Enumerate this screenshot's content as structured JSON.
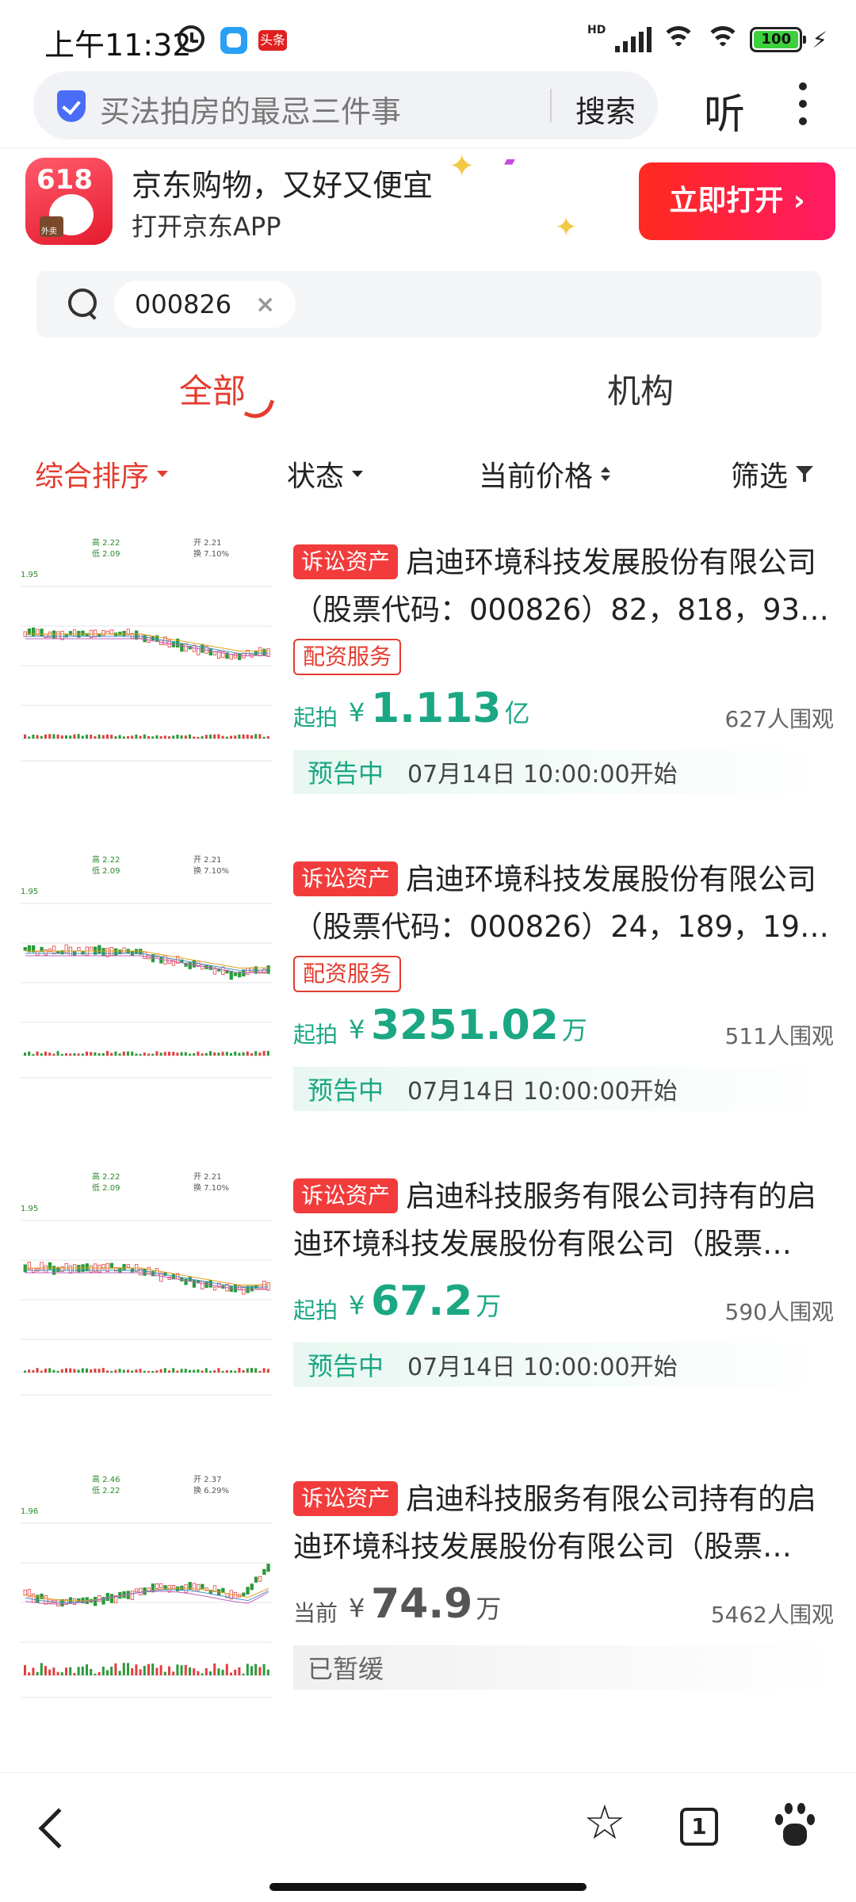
{
  "status_bar": {
    "time": "上午11:32",
    "news_badge": "头条",
    "network_badge": "HD",
    "battery": "100"
  },
  "browser": {
    "query": "买法拍房的最忌三件事",
    "search_label": "搜索",
    "listen_label": "听"
  },
  "jd_banner": {
    "logo_text": "618",
    "logo_tag": "外卖",
    "title": "京东购物，又好又便宜",
    "subtitle": "打开京东APP",
    "open_button": "立即打开 ›"
  },
  "search": {
    "chip_text": "000826",
    "clear_icon": "×"
  },
  "tabs": [
    {
      "label": "全部",
      "active": true
    },
    {
      "label": "机构",
      "active": false
    }
  ],
  "filters": {
    "sort": "综合排序",
    "status": "状态",
    "price": "当前价格",
    "filter": "筛选"
  },
  "listings": [
    {
      "tag": "诉讼资产",
      "title": "启迪环境科技发展股份有限公司（股票代码：000826）82，818，93…",
      "service_tag": "配资服务",
      "price_label": "起拍",
      "currency": "¥",
      "amount": "1.113",
      "unit": "亿",
      "watchers": "627人围观",
      "status": "预告中",
      "time": "07月14日 10:00:00开始"
    },
    {
      "tag": "诉讼资产",
      "title": "启迪环境科技发展股份有限公司（股票代码：000826）24，189，19…",
      "service_tag": "配资服务",
      "price_label": "起拍",
      "currency": "¥",
      "amount": "3251.02",
      "unit": "万",
      "watchers": "511人围观",
      "status": "预告中",
      "time": "07月14日 10:00:00开始"
    },
    {
      "tag": "诉讼资产",
      "title": "启迪科技服务有限公司持有的启迪环境科技发展股份有限公司（股票…",
      "price_label": "起拍",
      "currency": "¥",
      "amount": "67.2",
      "unit": "万",
      "watchers": "590人围观",
      "status": "预告中",
      "time": "07月14日 10:00:00开始"
    },
    {
      "tag": "诉讼资产",
      "title": "启迪科技服务有限公司持有的启迪环境科技发展股份有限公司（股票…",
      "price_label": "当前",
      "currency": "¥",
      "amount": "74.9",
      "unit": "万",
      "watchers": "5462人围观",
      "status": "已暂缓"
    }
  ],
  "thumb_labels": [
    {
      "high": "高 2.22",
      "low": "低 2.09",
      "open": "开 2.21",
      "change": "换 7.10%",
      "price": "1.95"
    },
    {
      "high": "高 2.22",
      "low": "低 2.09",
      "open": "开 2.21",
      "change": "换 7.10%",
      "price": "1.95"
    },
    {
      "high": "高 2.22",
      "low": "低 2.09",
      "open": "开 2.21",
      "change": "换 7.10%",
      "price": "1.95"
    },
    {
      "high": "高 2.46",
      "low": "低 2.22",
      "open": "开 2.37",
      "change": "换 6.29%",
      "price": "1.96"
    }
  ],
  "bottom_nav": {
    "tab_count": "1"
  },
  "colors": {
    "accent_red": "#e43c2f",
    "price_green": "#1ba784",
    "jd_red": "#ff2a1e"
  }
}
